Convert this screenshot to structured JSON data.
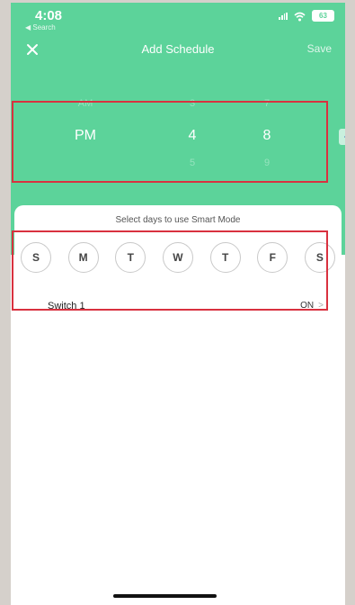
{
  "status": {
    "time": "4:08",
    "back_label": "◀ Search",
    "battery": "63"
  },
  "nav": {
    "title": "Add Schedule",
    "save_label": "Save",
    "close_icon": "close-icon"
  },
  "picker": {
    "columns": [
      {
        "prev": "AM",
        "selected": "PM",
        "next": ""
      },
      {
        "prev": "3",
        "selected": "4",
        "next": "5"
      },
      {
        "prev": "7",
        "selected": "8",
        "next": "9"
      }
    ]
  },
  "days": {
    "prompt": "Select days to use Smart Mode",
    "items": [
      "S",
      "M",
      "T",
      "W",
      "T",
      "F",
      "S"
    ]
  },
  "switch": {
    "label": "Switch 1",
    "status": "ON",
    "chevron": ">"
  },
  "colors": {
    "accent": "#5cd39a",
    "highlight": "#d9313f",
    "background": "#d5d0cb"
  }
}
